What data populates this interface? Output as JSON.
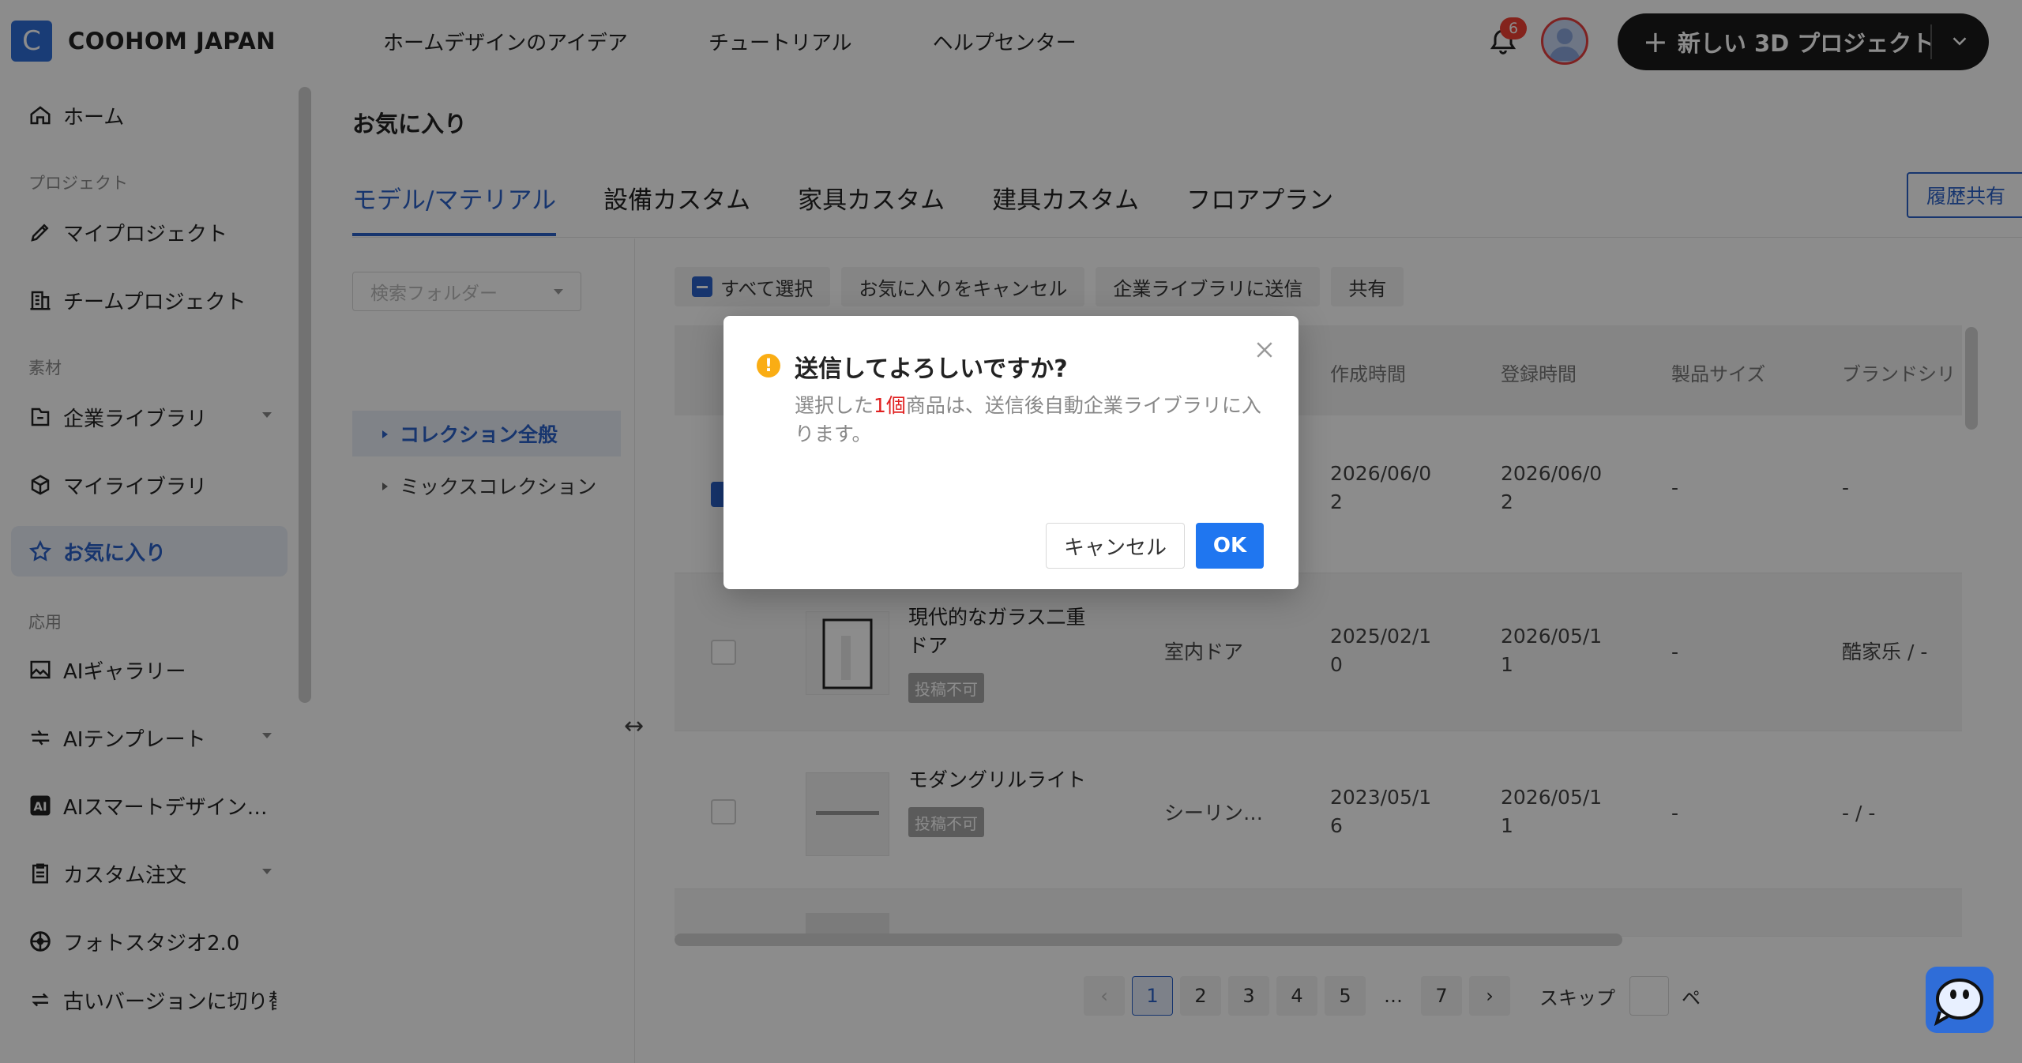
{
  "header": {
    "logo_letter": "C",
    "brand": "COOHOM JAPAN",
    "nav": [
      "ホームデザインのアイデア",
      "チュートリアル",
      "ヘルプセンター"
    ],
    "notification_count": "6",
    "new_project_label": "新しい 3D プロジェクト"
  },
  "sidebar": {
    "home": "ホーム",
    "section_project": "プロジェクト",
    "my_projects": "マイプロジェクト",
    "team_projects": "チームプロジェクト",
    "section_material": "素材",
    "enterprise_library": "企業ライブラリ",
    "my_library": "マイライブラリ",
    "favorites": "お気に入り",
    "section_apps": "応用",
    "ai_gallery": "AIギャラリー",
    "ai_template": "AIテンプレート",
    "ai_smart_design": "AIスマートデザイン…",
    "custom_order": "カスタム注文",
    "photo_studio": "フォトスタジオ2.0",
    "old_version": "古いバージョンに切り替え"
  },
  "main": {
    "page_title": "お気に入り",
    "tabs": [
      "モデル/マテリアル",
      "設備カスタム",
      "家具カスタム",
      "建具カスタム",
      "フロアプラン"
    ],
    "share_history": "履歴共有",
    "folder_placeholder": "検索フォルダー",
    "folders": [
      "コレクション全般",
      "ミックスコレクション"
    ],
    "toolbar": {
      "select_all": "すべて選択",
      "cancel_favorite": "お気に入りをキャンセル",
      "send_enterprise": "企業ライブラリに送信",
      "share": "共有"
    },
    "table": {
      "headers": [
        "作成時間",
        "登録時間",
        "製品サイズ",
        "ブランドシリ"
      ],
      "rows": [
        {
          "name": "",
          "tag": "",
          "category": "",
          "created": "2026/06/0\n2",
          "registered": "2026/06/0\n2",
          "size": "-",
          "brand": "-"
        },
        {
          "name": "現代的なガラス二重\nドア",
          "tag": "投稿不可",
          "category": "室内ドア",
          "created": "2025/02/1\n0",
          "registered": "2026/05/1\n1",
          "size": "-",
          "brand": "酷家乐 / -"
        },
        {
          "name": "モダングリルライト",
          "tag": "投稿不可",
          "category": "シーリン…",
          "created": "2023/05/1\n6",
          "registered": "2026/05/1\n1",
          "size": "-",
          "brand": "- / -"
        }
      ]
    },
    "pagination": {
      "pages": [
        "1",
        "2",
        "3",
        "4",
        "5",
        "…",
        "7"
      ],
      "current": "1",
      "skip_label": "スキップ",
      "suffix": "ペ"
    }
  },
  "modal": {
    "title": "送信してよろしいですか?",
    "body_prefix": "選択した",
    "body_highlight": "1個",
    "body_suffix": "商品は、送信後自動企業ライブラリに入ります。",
    "cancel_label": "キャンセル",
    "ok_label": "OK"
  },
  "colors": {
    "accent": "#2a62c9",
    "ok_button": "#1f76f0",
    "warning": "#faad14",
    "highlight": "#e02020",
    "badge": "#f04134"
  }
}
